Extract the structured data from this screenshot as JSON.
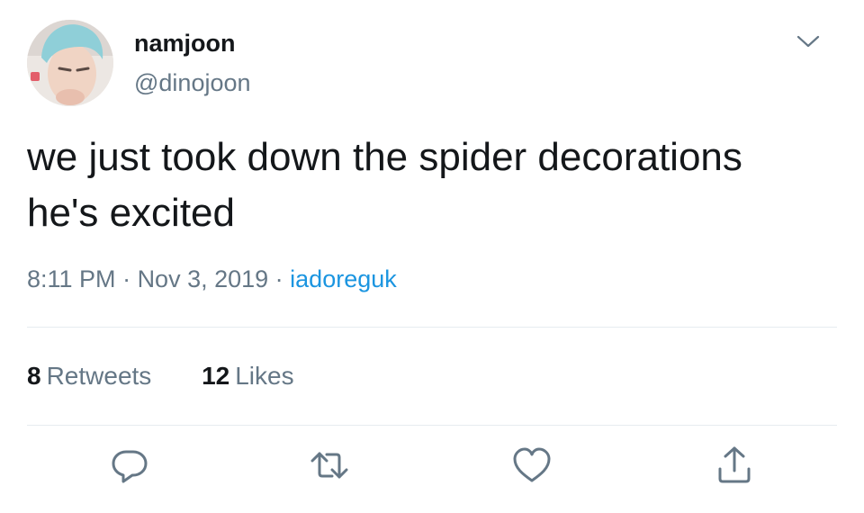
{
  "user": {
    "display_name": "namjoon",
    "handle": "@dinojoon"
  },
  "tweet": {
    "lines": [
      "we just took down the spider decorations",
      "he's excited"
    ]
  },
  "meta": {
    "time": "8:11 PM",
    "separator": " · ",
    "date": "Nov 3, 2019",
    "source": "iadoreguk"
  },
  "stats": {
    "retweets": {
      "count": "8",
      "label": "Retweets"
    },
    "likes": {
      "count": "12",
      "label": "Likes"
    }
  },
  "icons": {
    "more": "chevron-down-icon",
    "reply": "reply-icon",
    "retweet": "retweet-icon",
    "like": "heart-icon",
    "share": "share-icon"
  },
  "colors": {
    "text": "#14171a",
    "secondary": "#657786",
    "link": "#1b95e0",
    "divider": "#e6ecf0"
  }
}
